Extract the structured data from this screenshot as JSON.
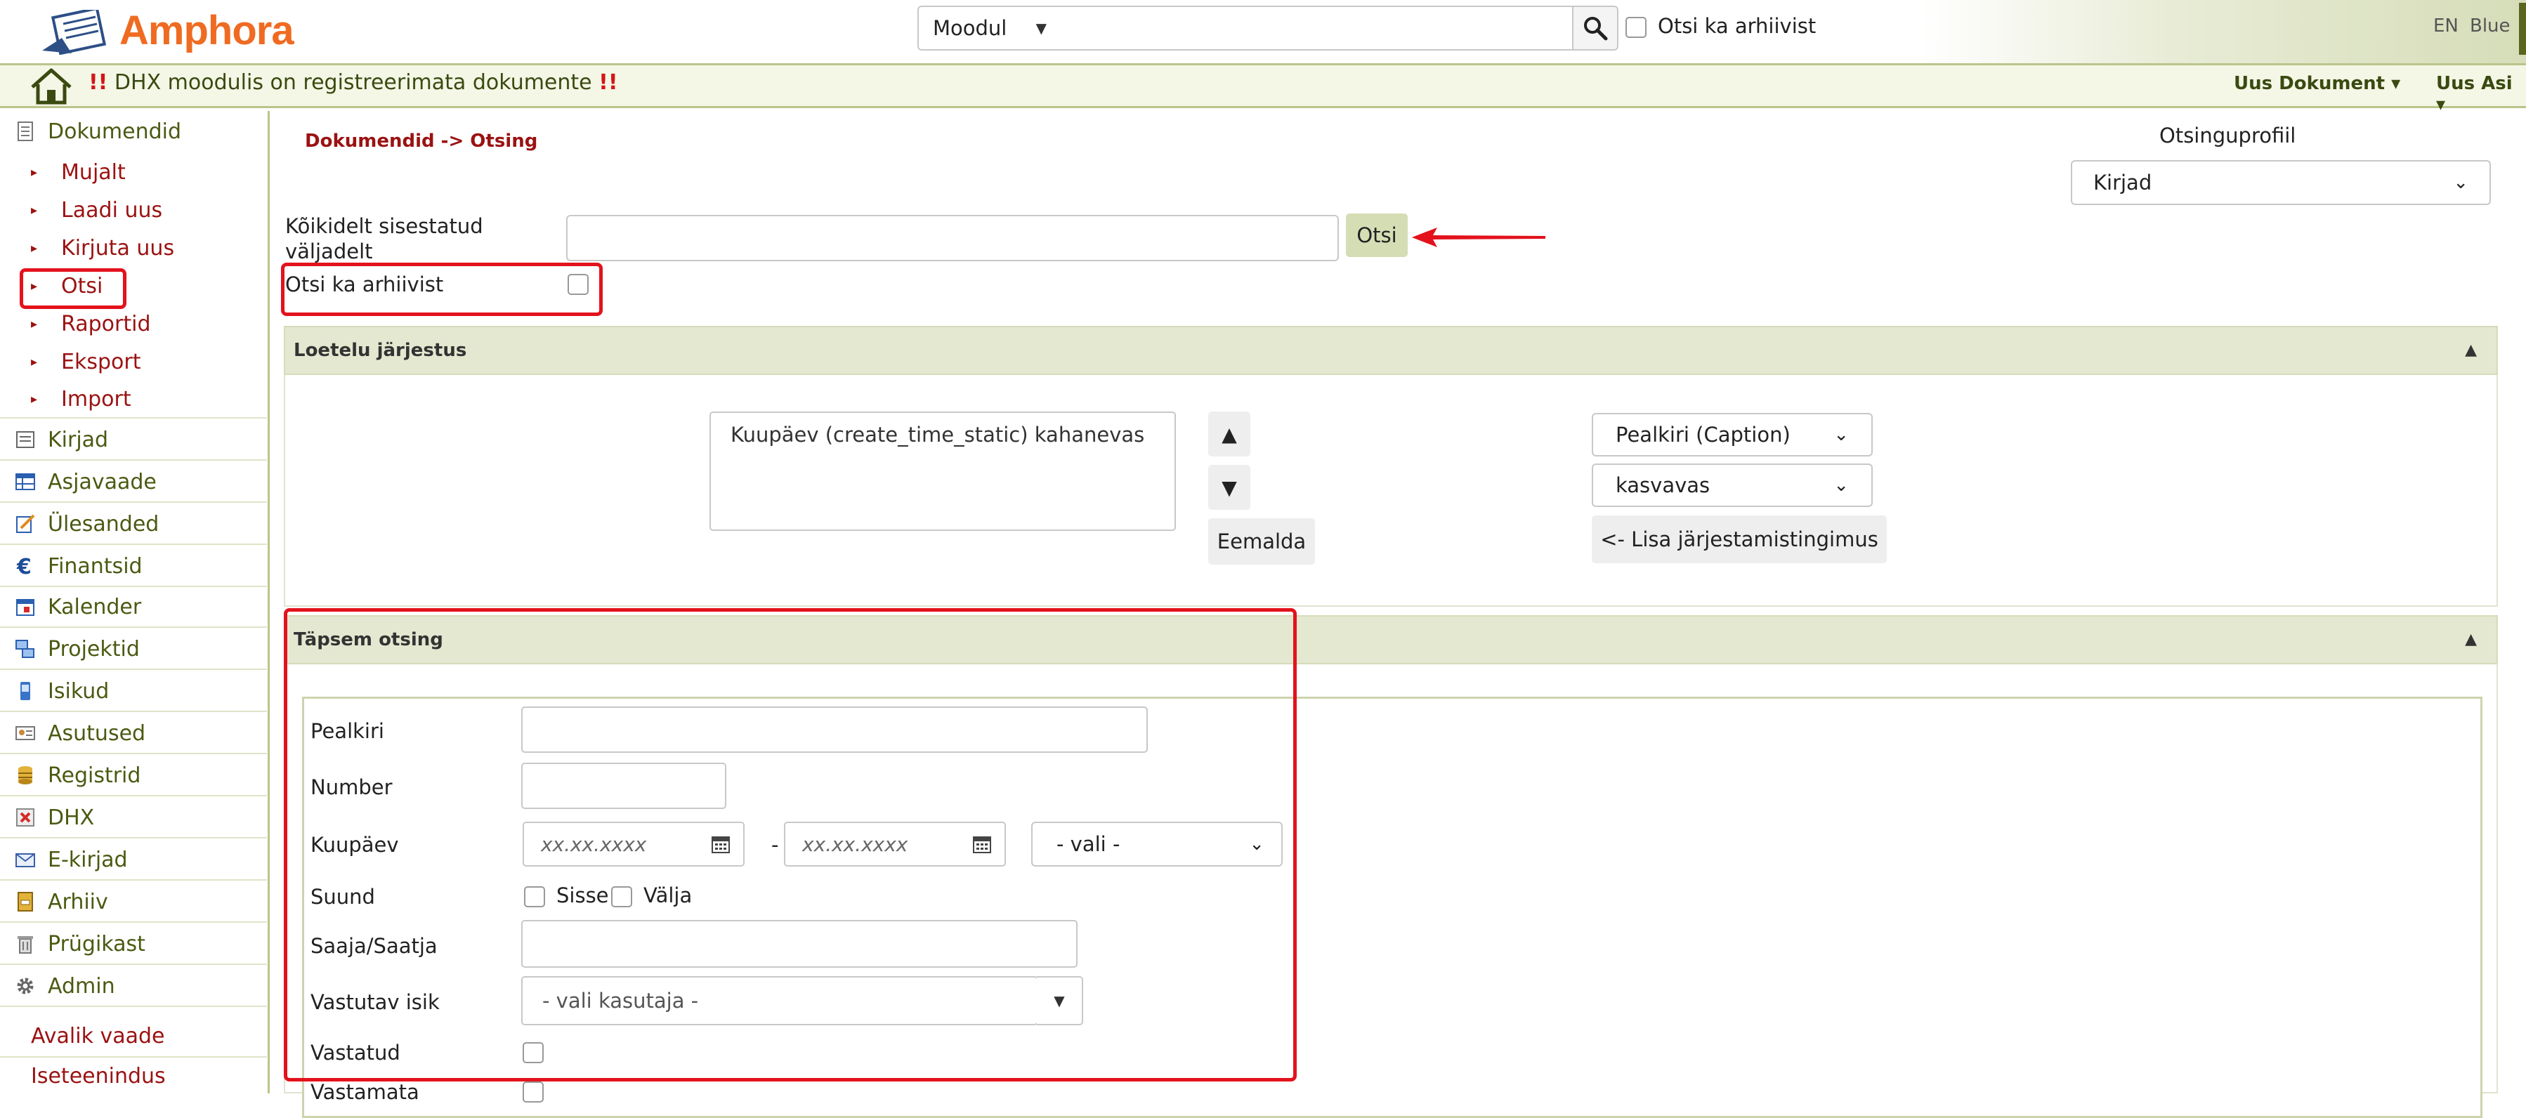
{
  "app": {
    "name": "Amphora",
    "accent": "#ef6b22",
    "annotation_color": "#e3121c"
  },
  "header": {
    "module_select": "Moodul",
    "search_value": "",
    "archive_label": "Otsi ka arhiivist",
    "lang": "EN",
    "theme": "Blue"
  },
  "notice": {
    "marker": "!!",
    "text": "DHX moodulis on registreerimata dokumente",
    "menu_new_document": "Uus Dokument ▾",
    "menu_new_thing": "Uus Asi ▾"
  },
  "sidebar": {
    "documents": "Dokumendid",
    "sub": [
      "Mujalt",
      "Laadi uus",
      "Kirjuta uus",
      "Otsi",
      "Raportid",
      "Eksport",
      "Import"
    ],
    "items": [
      {
        "label": "Kirjad",
        "icon": "letter-icon"
      },
      {
        "label": "Asjavaade",
        "icon": "table-view-icon"
      },
      {
        "label": "Ülesanded",
        "icon": "task-icon"
      },
      {
        "label": "Finantsid",
        "icon": "euro-icon"
      },
      {
        "label": "Kalender",
        "icon": "calendar-icon"
      },
      {
        "label": "Projektid",
        "icon": "project-icon"
      },
      {
        "label": "Isikud",
        "icon": "phone-icon"
      },
      {
        "label": "Asutused",
        "icon": "id-card-icon"
      },
      {
        "label": "Registrid",
        "icon": "database-icon"
      },
      {
        "label": "DHX",
        "icon": "dhx-icon"
      },
      {
        "label": "E-kirjad",
        "icon": "envelope-icon"
      },
      {
        "label": "Arhiiv",
        "icon": "archive-icon"
      },
      {
        "label": "Prügikast",
        "icon": "trash-icon"
      },
      {
        "label": "Admin",
        "icon": "gear-icon"
      }
    ],
    "links": [
      "Avalik vaade",
      "Iseteenindus"
    ]
  },
  "main": {
    "breadcrumb": "Dokumendid -> Otsing",
    "profile_label": "Otsinguprofiil",
    "profile_value": "Kirjad",
    "all_fields_label": "Kõikidelt sisestatud väljadelt",
    "all_fields_value": "",
    "search_button": "Otsi",
    "archive_label": "Otsi ka arhiivist"
  },
  "sort": {
    "title": "Loetelu järjestus",
    "list": [
      "Kuupäev (create_time_static) kahanevas"
    ],
    "up": "▲",
    "down": "▼",
    "remove": "Eemalda",
    "field_value": "Pealkiri (Caption)",
    "direction_value": "kasvavas",
    "add": "<- Lisa järjestamistingimus"
  },
  "advanced": {
    "title": "Täpsem otsing",
    "caption_label": "Pealkiri",
    "number_label": "Number",
    "date_label": "Kuupäev",
    "date_placeholder": "xx.xx.xxxx",
    "date_sep": "-",
    "period_value": "- vali -",
    "direction_label": "Suund",
    "direction_in": "Sisse",
    "direction_out": "Välja",
    "recipient_label": "Saaja/Saatja",
    "responsible_label": "Vastutav isik",
    "responsible_value": "- vali kasutaja -",
    "answered_label": "Vastatud",
    "unanswered_label": "Vastamata"
  }
}
